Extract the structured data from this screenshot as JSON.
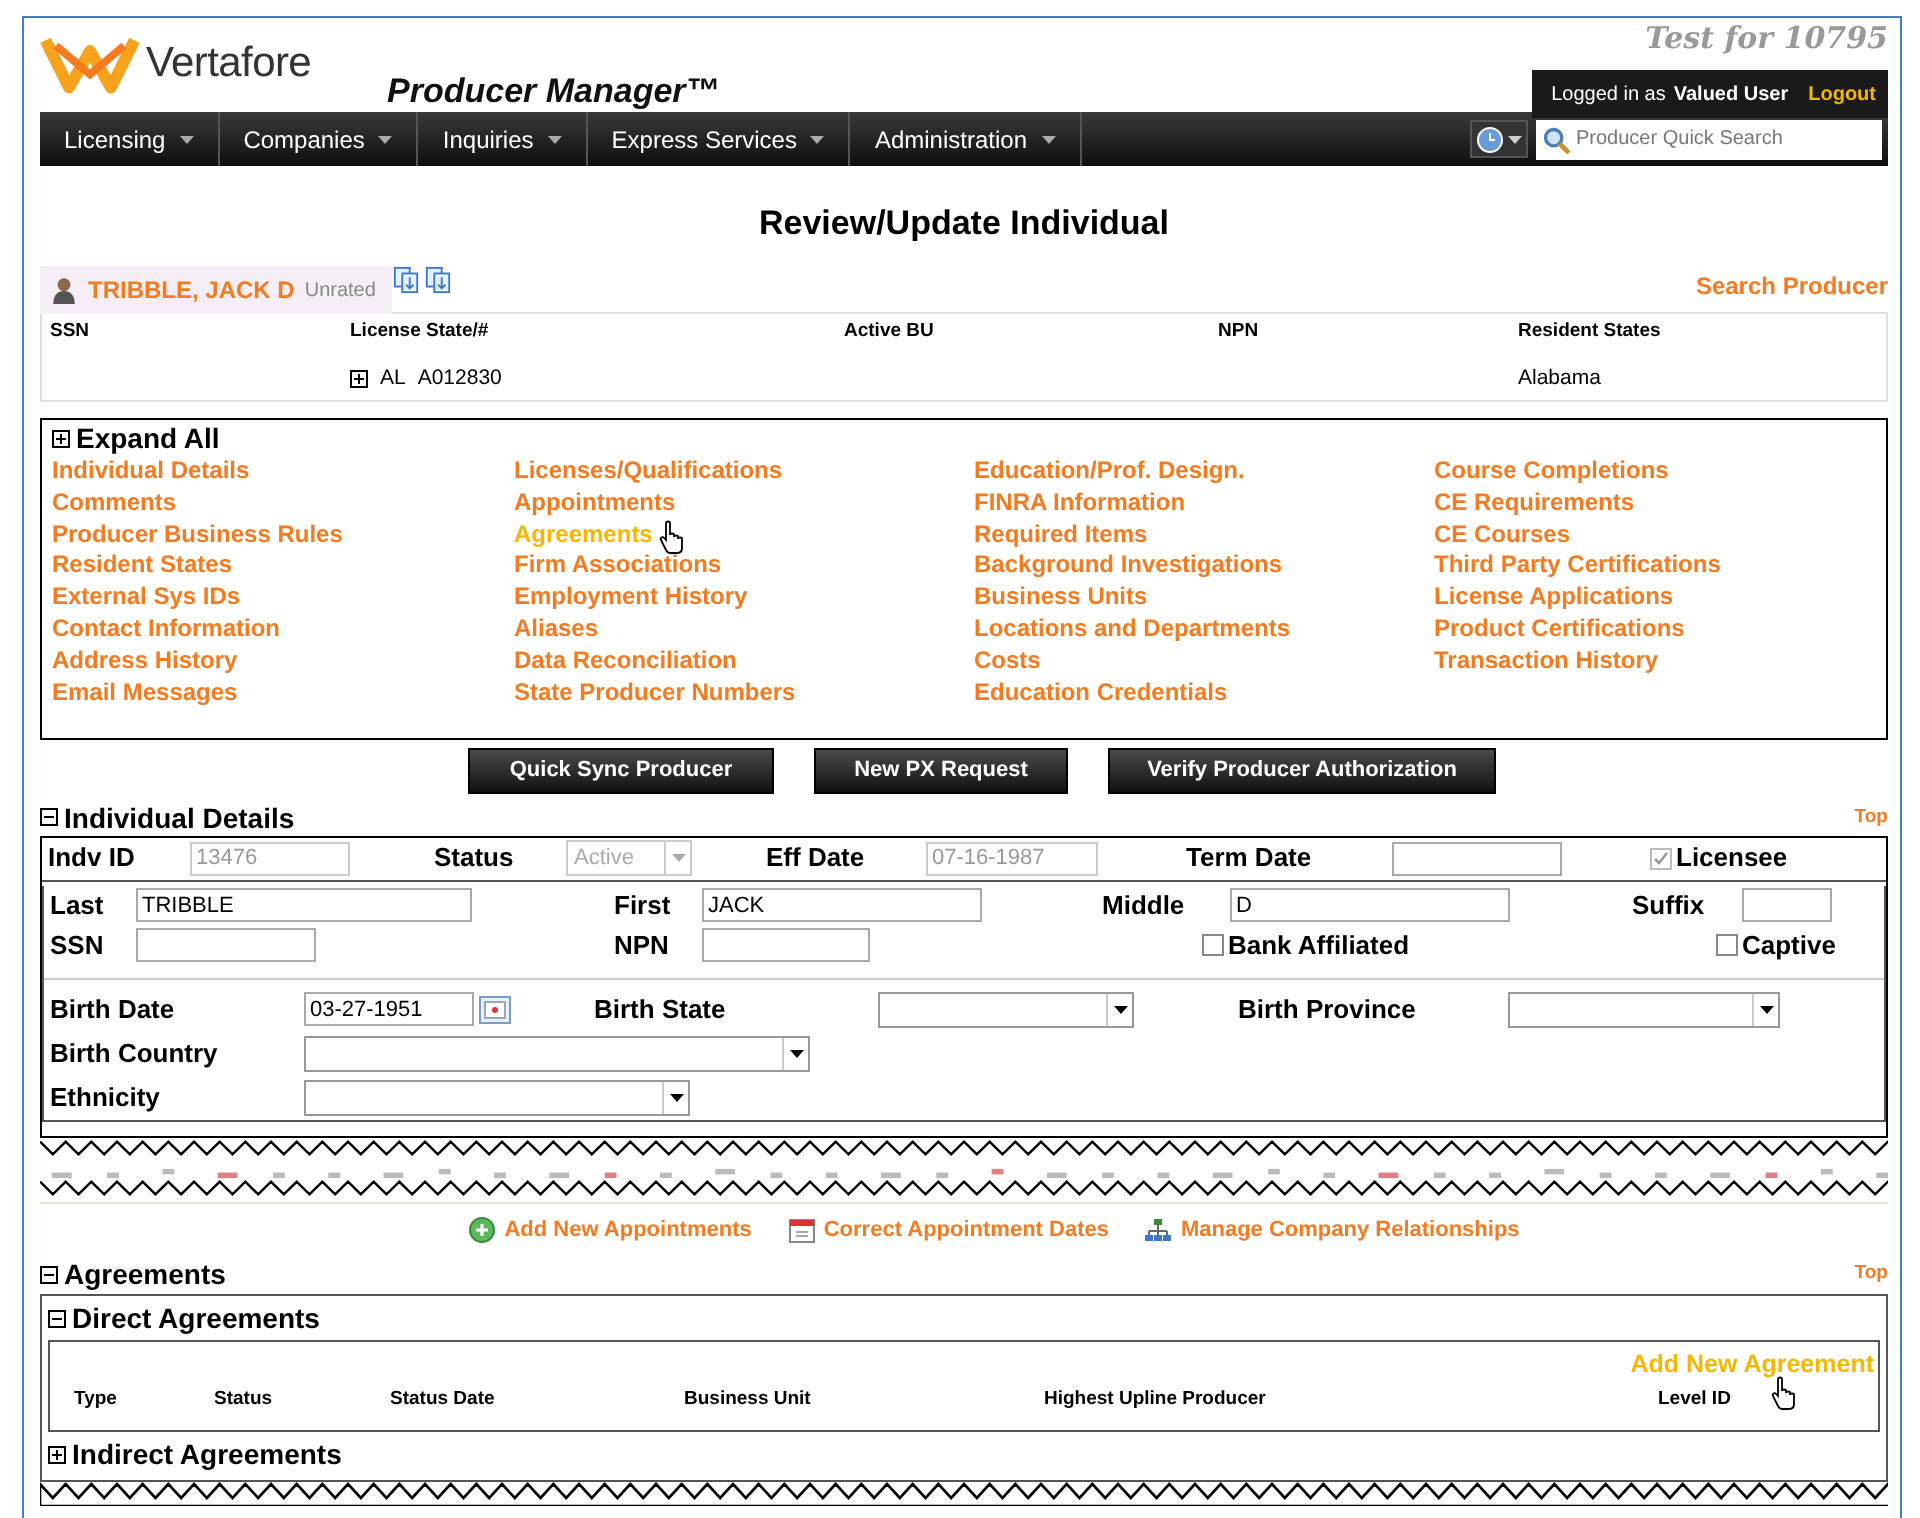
{
  "header": {
    "logo_text": "Vertafore",
    "app_title": "Producer Manager™",
    "environment": "Test for 10795",
    "login_prefix": "Logged in as",
    "user": "Valued User",
    "logout": "Logout"
  },
  "menu": [
    "Licensing",
    "Companies",
    "Inquiries",
    "Express Services",
    "Administration"
  ],
  "quick_search": {
    "placeholder": "Producer Quick Search"
  },
  "page_title": "Review/Update Individual",
  "producer": {
    "name": "TRIBBLE, JACK D",
    "rating": "Unrated",
    "search_link": "Search Producer"
  },
  "summary": {
    "columns": [
      "SSN",
      "License State/#",
      "Active BU",
      "NPN",
      "Resident States"
    ],
    "rows": [
      {
        "expanded": false,
        "license_state": "AL",
        "license_number": "A012830",
        "resident_states": "Alabama"
      }
    ]
  },
  "quick_links": {
    "expand_all": {
      "label": "Expand All",
      "expanded": false
    },
    "columns": [
      [
        {
          "label": "Individual Details",
          "hovered": false
        },
        {
          "label": "Comments",
          "hovered": false
        },
        {
          "label": "Producer Business Rules",
          "hovered": false
        },
        {
          "label": "Resident States",
          "hovered": false
        },
        {
          "label": "External Sys IDs",
          "hovered": false
        },
        {
          "label": "Contact Information",
          "hovered": false
        },
        {
          "label": "Address History",
          "hovered": false
        },
        {
          "label": "Email Messages",
          "hovered": false
        }
      ],
      [
        {
          "label": "Licenses/Qualifications",
          "hovered": false
        },
        {
          "label": "Appointments",
          "hovered": false
        },
        {
          "label": "Agreements",
          "hovered": true
        },
        {
          "label": "Firm Associations",
          "hovered": false
        },
        {
          "label": "Employment History",
          "hovered": false
        },
        {
          "label": "Aliases",
          "hovered": false
        },
        {
          "label": "Data Reconciliation",
          "hovered": false
        },
        {
          "label": "State Producer Numbers",
          "hovered": false
        }
      ],
      [
        {
          "label": "Education/Prof. Design.",
          "hovered": false
        },
        {
          "label": "FINRA Information",
          "hovered": false
        },
        {
          "label": "Required Items",
          "hovered": false
        },
        {
          "label": "Background Investigations",
          "hovered": false
        },
        {
          "label": "Business Units",
          "hovered": false
        },
        {
          "label": "Locations and Departments",
          "hovered": false
        },
        {
          "label": "Costs",
          "hovered": false
        },
        {
          "label": "Education Credentials",
          "hovered": false
        }
      ],
      [
        {
          "label": "Course Completions",
          "hovered": false
        },
        {
          "label": "CE Requirements",
          "hovered": false
        },
        {
          "label": "CE Courses",
          "hovered": false
        },
        {
          "label": "Third Party Certifications",
          "hovered": false
        },
        {
          "label": "License Applications",
          "hovered": false
        },
        {
          "label": "Product Certifications",
          "hovered": false
        },
        {
          "label": "Transaction History",
          "hovered": false
        }
      ]
    ]
  },
  "actions": [
    "Quick Sync Producer",
    "New PX Request",
    "Verify Producer Authorization"
  ],
  "individual_details": {
    "title": "Individual Details",
    "expanded": true,
    "top_link": "Top",
    "indv_id": {
      "label": "Indv ID",
      "value": "13476",
      "disabled": true
    },
    "status": {
      "label": "Status",
      "value": "Active",
      "disabled": true
    },
    "eff_date": {
      "label": "Eff Date",
      "value": "07-16-1987",
      "disabled": true
    },
    "term_date": {
      "label": "Term Date"
    },
    "licensee": {
      "label": "Licensee",
      "checked": true,
      "disabled": true
    },
    "last": {
      "label": "Last",
      "value": "TRIBBLE"
    },
    "first": {
      "label": "First",
      "value": "JACK"
    },
    "middle": {
      "label": "Middle",
      "value": "D"
    },
    "suffix": {
      "label": "Suffix"
    },
    "ssn": {
      "label": "SSN"
    },
    "npn": {
      "label": "NPN"
    },
    "bank_affiliated": {
      "label": "Bank Affiliated",
      "checked": false
    },
    "captive": {
      "label": "Captive",
      "checked": false
    },
    "birth_date": {
      "label": "Birth Date",
      "value": "03-27-1951"
    },
    "birth_state": {
      "label": "Birth State"
    },
    "birth_province": {
      "label": "Birth Province"
    },
    "birth_country": {
      "label": "Birth Country"
    },
    "ethnicity": {
      "label": "Ethnicity"
    }
  },
  "appointment_links": [
    {
      "kind": "add",
      "label": "Add New Appointments"
    },
    {
      "kind": "calendar",
      "label": "Correct Appointment Dates"
    },
    {
      "kind": "hierarchy",
      "label": "Manage Company Relationships"
    }
  ],
  "agreements": {
    "title": "Agreements",
    "expanded": true,
    "top_link": "Top",
    "direct": {
      "title": "Direct Agreements",
      "expanded": true,
      "add_link": {
        "label": "Add New Agreement",
        "hovered": true
      },
      "columns": [
        "Type",
        "Status",
        "Status Date",
        "Business Unit",
        "Highest Upline Producer",
        "Level ID"
      ]
    },
    "indirect": {
      "title": "Indirect Agreements",
      "expanded": false
    }
  }
}
